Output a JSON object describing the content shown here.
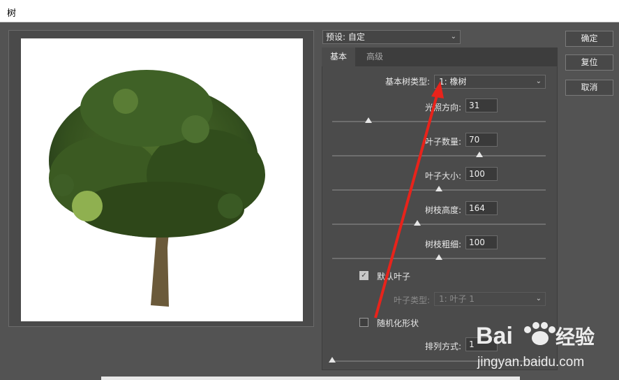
{
  "window": {
    "title": "树"
  },
  "preset": {
    "value": "预设: 自定"
  },
  "tabs": [
    {
      "label": "基本"
    },
    {
      "label": "高级"
    }
  ],
  "tree_type": {
    "label": "基本树类型:",
    "value": "1: 橡树"
  },
  "params": [
    {
      "label": "光照方向:",
      "value": "31",
      "level": 0.17
    },
    {
      "label": "叶子数量:",
      "value": "70",
      "level": 0.69
    },
    {
      "label": "叶子大小:",
      "value": "100",
      "level": 0.5
    },
    {
      "label": "树枝高度:",
      "value": "164",
      "level": 0.4
    },
    {
      "label": "树枝粗细:",
      "value": "100",
      "level": 0.5
    }
  ],
  "default_leaves": {
    "label": "默认叶子",
    "checked": true
  },
  "leaf_type": {
    "label": "叶子类型:",
    "value": "1: 叶子 1"
  },
  "randomize": {
    "label": "随机化形状",
    "checked": false
  },
  "arrangement": {
    "label": "排列方式:",
    "value": "1",
    "level": 0.0
  },
  "buttons": {
    "ok": "确定",
    "reset": "复位",
    "cancel": "取消"
  },
  "watermark": {
    "brand": "Bai",
    "brand2": "经验",
    "url": "jingyan.baidu.com"
  },
  "colors": {
    "annotation_arrow": "#e8231b",
    "tree_foliage": "#3a5a22",
    "trunk": "#6b5a3a"
  }
}
